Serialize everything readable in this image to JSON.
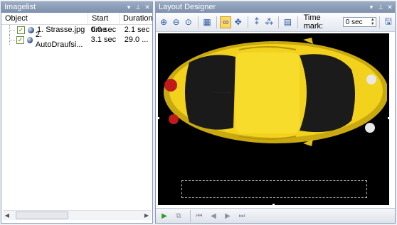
{
  "imagelist": {
    "title": "Imagelist",
    "title_buttons": [
      "▾",
      "⊥",
      "✕"
    ],
    "columns": [
      "Object",
      "Start time",
      "Duration"
    ],
    "rows": [
      {
        "name": "1. Strasse.jpg",
        "start": "0.0 sec",
        "duration": "2.1 sec",
        "checked": true
      },
      {
        "name": "2. AutoDraufsi...",
        "start": "3.1 sec",
        "duration": "29.0 ...",
        "checked": true
      }
    ],
    "scroll_left": "◀",
    "scroll_right": "▶"
  },
  "designer": {
    "title": "Layout Designer",
    "title_buttons": [
      "▾",
      "⊥",
      "✕"
    ],
    "toolbar_icons": [
      "zoom-in-icon",
      "zoom-out-icon",
      "zoom-fit-icon",
      "grid-icon",
      "link-icon",
      "move-icon",
      "add-keyframe-icon",
      "remove-keyframe-icon",
      "text-icon"
    ],
    "time_mark_label": "Time mark:",
    "time_mark_value": "0 sec",
    "car_color": "#f2d21c",
    "bottom_icons": [
      "play-icon",
      "preview-icon",
      "first-frame-icon",
      "previous-frame-icon",
      "next-frame-icon",
      "last-frame-icon"
    ]
  }
}
